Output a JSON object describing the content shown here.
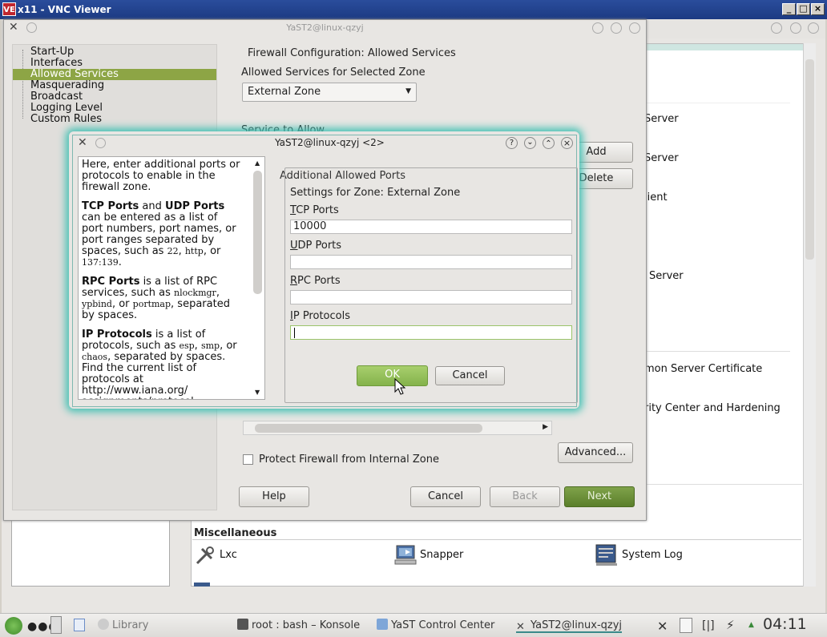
{
  "vnc": {
    "title": "x11 - VNC Viewer",
    "icon_text": "VE",
    "min_label": "_",
    "max_label": "□",
    "close_label": "×"
  },
  "control_center": {
    "title": "",
    "items": [
      {
        "label": "Server"
      },
      {
        "label": "Server"
      },
      {
        "label": "lient"
      },
      {
        "label": "Server"
      },
      {
        "label": "mon Server Certificate"
      },
      {
        "label": "rity Center and Hardening"
      }
    ],
    "misc_heading": "Miscellaneous",
    "misc_items": [
      {
        "label": "Lxc",
        "icon": "wrench-icon"
      },
      {
        "label": "Snapper",
        "icon": "computer-icon"
      },
      {
        "label": "System Log",
        "icon": "log-icon"
      }
    ]
  },
  "firewall": {
    "window_title": "YaST2@linux-qzyj",
    "tree": [
      "Start-Up",
      "Interfaces",
      "Allowed Services",
      "Masquerading",
      "Broadcast",
      "Logging Level",
      "Custom Rules"
    ],
    "selected_index": 2,
    "heading": "Firewall Configuration: Allowed Services",
    "zone_label": "Allowed Services for Selected Zone",
    "zone_value": "External Zone",
    "service_label": "Service to Allow",
    "add_label": "Add",
    "delete_label": "Delete",
    "protect_label": "Protect Firewall from Internal Zone",
    "protect_checked": false,
    "advanced_label": "Advanced...",
    "help_label": "Help",
    "cancel_label": "Cancel",
    "back_label": "Back",
    "next_label": "Next"
  },
  "dialog": {
    "title": "YaST2@linux-qzyj <2>",
    "help_paragraphs": {
      "p1": "Here, enter additional ports or protocols to enable in the firewall zone.",
      "p2_b1": "TCP Ports",
      "p2_and": " and ",
      "p2_b2": "UDP Ports",
      "p2_rest": " can be entered as a list of port numbers, port names, or port ranges separated by spaces, such as ",
      "p2_m1": "22",
      "p2_sep1": ", ",
      "p2_m2": "http",
      "p2_sep2": ", or ",
      "p2_m3": "137:139",
      "p2_end": ".",
      "p3_b": "RPC Ports",
      "p3_rest": " is a list of RPC services, such as ",
      "p3_m1": "nlockmgr",
      "p3_sep1": ", ",
      "p3_m2": "ypbind",
      "p3_sep2": ", or ",
      "p3_m3": "portmap",
      "p3_end": ", separated by spaces.",
      "p4_b": "IP Protocols",
      "p4_rest": " is a list of protocols, such as ",
      "p4_m1": "esp",
      "p4_sep1": ", ",
      "p4_m2": "smp",
      "p4_sep2": ", or ",
      "p4_m3": "chaos",
      "p4_end": ", separated by spaces. Find the current list of protocols at http://www.iana.org/ assignments/protocol-numbers."
    },
    "group_title": "Additional Allowed Ports",
    "zone_settings": "Settings for Zone: External Zone",
    "tcp_label": "CP Ports",
    "tcp_label_accel": "T",
    "tcp_value": "10000",
    "udp_label": "DP Ports",
    "udp_label_accel": "U",
    "udp_value": "",
    "rpc_label": "PC Ports",
    "rpc_label_accel": "R",
    "rpc_value": "",
    "ip_label": "P Protocols",
    "ip_label_accel": "I",
    "ip_value": "",
    "ok_label": "OK",
    "cancel_label": "Cancel",
    "help_btn": "?",
    "down_btn": "⌄",
    "up_btn": "⌃",
    "close_btn": "×"
  },
  "taskbar": {
    "items": [
      {
        "label": "Library"
      },
      {
        "label": "root : bash – Konsole"
      },
      {
        "label": "YaST Control Center"
      },
      {
        "label": "YaST2@linux-qzyj"
      }
    ],
    "clock": "04:11"
  }
}
